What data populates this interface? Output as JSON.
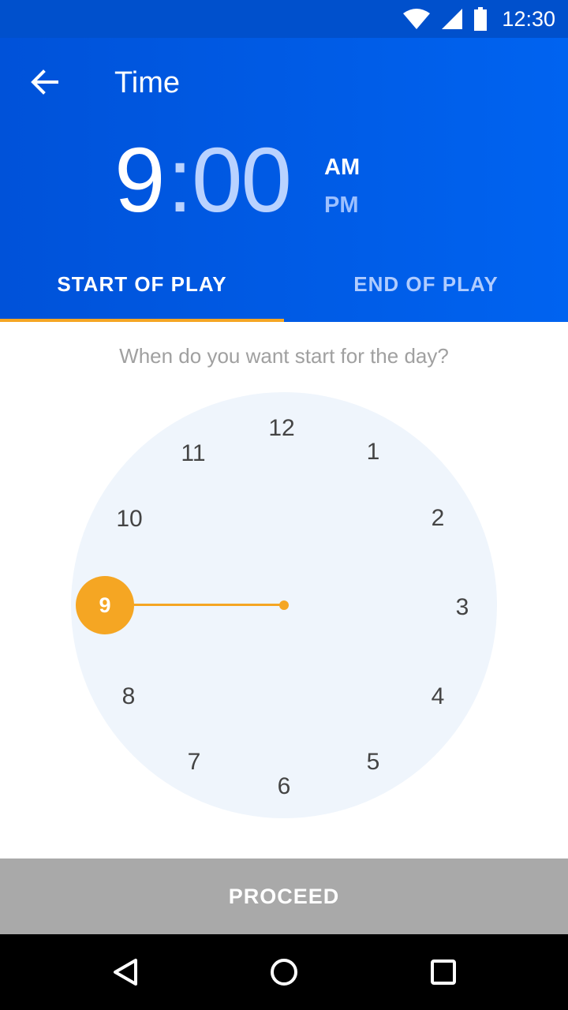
{
  "status_bar": {
    "time": "12:30"
  },
  "header": {
    "title": "Time",
    "back_icon": "arrow-left-icon"
  },
  "time_display": {
    "hour": "9",
    "separator": ":",
    "minutes": "00",
    "am": "AM",
    "pm": "PM",
    "selected_period": "AM"
  },
  "tabs": [
    {
      "label": "START OF PLAY",
      "active": true
    },
    {
      "label": "END OF PLAY",
      "active": false
    }
  ],
  "prompt": "When do you want start for the day?",
  "clock": {
    "numbers": [
      "12",
      "1",
      "2",
      "3",
      "4",
      "5",
      "6",
      "7",
      "8",
      "9",
      "10",
      "11"
    ],
    "selected_hour": "9"
  },
  "proceed_label": "PROCEED",
  "colors": {
    "primary": "#0060ea",
    "accent": "#f5a623",
    "disabled": "#a9a9a9"
  }
}
